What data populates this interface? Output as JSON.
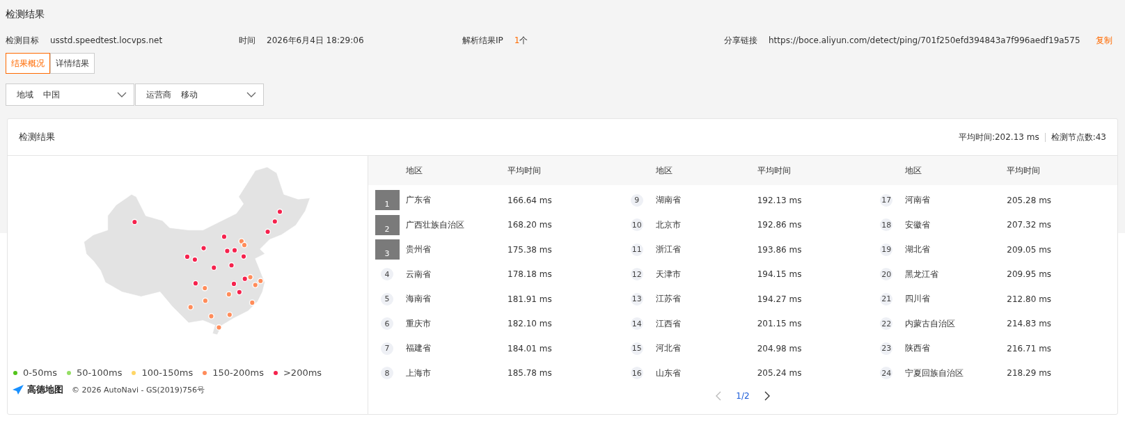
{
  "page_title": "检测结果",
  "info": [
    {
      "label": "检测目标",
      "value": "usstd.speedtest.locvps.net"
    },
    {
      "label": "时间",
      "value": "2026年6月4日 18:29:06"
    },
    {
      "label": "解析结果IP",
      "count": "1",
      "unit": "个"
    },
    {
      "label": "分享链接",
      "value": "https://boce.aliyun.com/detect/ping/701f250efd394843a7f996aedf19a575",
      "action": "复制"
    }
  ],
  "tabs": [
    {
      "label": "结果概况",
      "selected": true
    },
    {
      "label": "详情结果",
      "selected": false
    }
  ],
  "filters": [
    {
      "label": "地域",
      "value": "中国"
    },
    {
      "label": "运营商",
      "value": "移动"
    }
  ],
  "card": {
    "title": "检测结果",
    "avg": "平均时间:202.13 ms",
    "nodes": "检测节点数:43"
  },
  "legend": [
    {
      "label": "0-50ms",
      "color": "#52c41a"
    },
    {
      "label": "50-100ms",
      "color": "#95de64"
    },
    {
      "label": "100-150ms",
      "color": "#ffd666"
    },
    {
      "label": "150-200ms",
      "color": "#ff8c5a"
    },
    {
      "label": ">200ms",
      "color": "#f5224d"
    }
  ],
  "map_brand": "高德地图",
  "map_copyright": "© 2026 AutoNavi - GS(2019)756号",
  "table": {
    "columns": [
      "地区",
      "平均时间",
      "地区",
      "平均时间",
      "地区",
      "平均时间"
    ],
    "rows": [
      {
        "rank": "1",
        "kind": "top",
        "region": "广东省",
        "time": "166.64 ms"
      },
      {
        "rank": "2",
        "kind": "top",
        "region": "广西壮族自治区",
        "time": "168.20 ms"
      },
      {
        "rank": "3",
        "kind": "top",
        "region": "贵州省",
        "time": "175.38 ms"
      },
      {
        "rank": "4",
        "kind": "plain",
        "region": "云南省",
        "time": "178.18 ms"
      },
      {
        "rank": "5",
        "kind": "plain",
        "region": "海南省",
        "time": "181.91 ms"
      },
      {
        "rank": "6",
        "kind": "plain",
        "region": "重庆市",
        "time": "182.10 ms"
      },
      {
        "rank": "7",
        "kind": "plain",
        "region": "福建省",
        "time": "184.01 ms"
      },
      {
        "rank": "8",
        "kind": "plain",
        "region": "上海市",
        "time": "185.78 ms"
      },
      {
        "rank": "9",
        "kind": "plain",
        "region": "湖南省",
        "time": "192.13 ms"
      },
      {
        "rank": "10",
        "kind": "plain",
        "region": "北京市",
        "time": "192.86 ms"
      },
      {
        "rank": "11",
        "kind": "plain",
        "region": "浙江省",
        "time": "193.86 ms"
      },
      {
        "rank": "12",
        "kind": "plain",
        "region": "天津市",
        "time": "194.15 ms"
      },
      {
        "rank": "13",
        "kind": "plain",
        "region": "江苏省",
        "time": "194.27 ms"
      },
      {
        "rank": "14",
        "kind": "plain",
        "region": "江西省",
        "time": "201.15 ms"
      },
      {
        "rank": "15",
        "kind": "plain",
        "region": "河北省",
        "time": "204.98 ms"
      },
      {
        "rank": "16",
        "kind": "plain",
        "region": "山东省",
        "time": "205.24 ms"
      },
      {
        "rank": "17",
        "kind": "plain",
        "region": "河南省",
        "time": "205.28 ms"
      },
      {
        "rank": "18",
        "kind": "plain",
        "region": "安徽省",
        "time": "207.32 ms"
      },
      {
        "rank": "19",
        "kind": "plain",
        "region": "湖北省",
        "time": "209.05 ms"
      },
      {
        "rank": "20",
        "kind": "plain",
        "region": "黑龙江省",
        "time": "209.95 ms"
      },
      {
        "rank": "21",
        "kind": "plain",
        "region": "四川省",
        "time": "212.80 ms"
      },
      {
        "rank": "22",
        "kind": "plain",
        "region": "内蒙古自治区",
        "time": "214.83 ms"
      },
      {
        "rank": "23",
        "kind": "plain",
        "region": "陕西省",
        "time": "216.71 ms"
      },
      {
        "rank": "24",
        "kind": "plain",
        "region": "宁夏回族自治区",
        "time": "218.29 ms"
      }
    ]
  },
  "pager": {
    "page": "1/2"
  }
}
